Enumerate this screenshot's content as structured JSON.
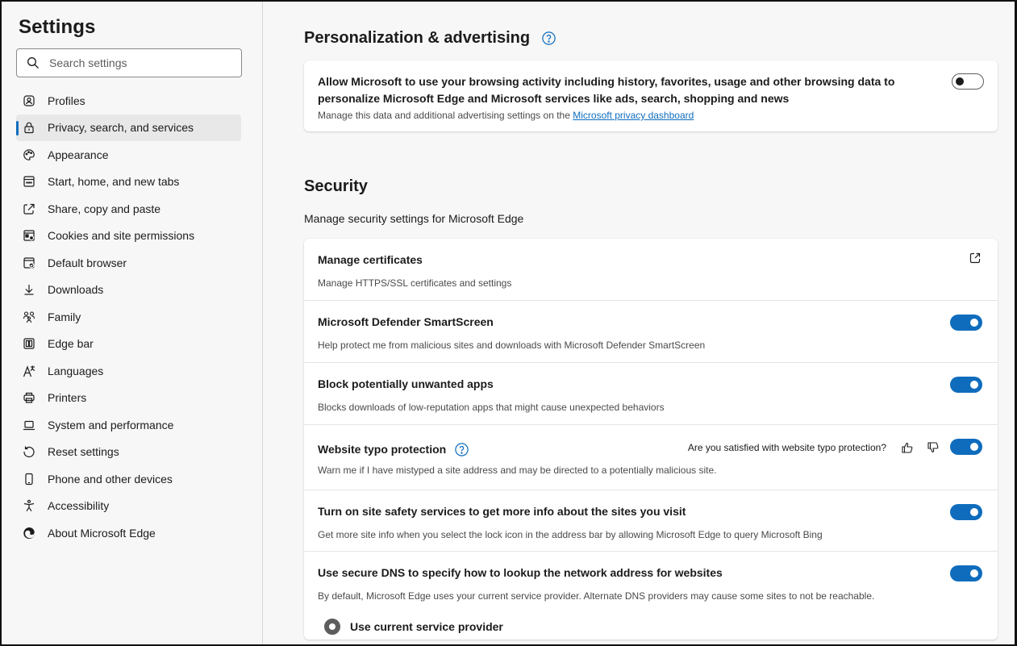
{
  "sidebar": {
    "title": "Settings",
    "search_placeholder": "Search settings",
    "items": [
      {
        "label": "Profiles",
        "icon": "profile-icon"
      },
      {
        "label": "Privacy, search, and services",
        "icon": "lock-icon",
        "active": true
      },
      {
        "label": "Appearance",
        "icon": "palette-icon"
      },
      {
        "label": "Start, home, and new tabs",
        "icon": "home-tab-icon"
      },
      {
        "label": "Share, copy and paste",
        "icon": "share-icon"
      },
      {
        "label": "Cookies and site permissions",
        "icon": "cookie-icon"
      },
      {
        "label": "Default browser",
        "icon": "browser-icon"
      },
      {
        "label": "Downloads",
        "icon": "download-icon"
      },
      {
        "label": "Family",
        "icon": "family-icon"
      },
      {
        "label": "Edge bar",
        "icon": "edge-bar-icon"
      },
      {
        "label": "Languages",
        "icon": "language-icon"
      },
      {
        "label": "Printers",
        "icon": "printer-icon"
      },
      {
        "label": "System and performance",
        "icon": "laptop-icon"
      },
      {
        "label": "Reset settings",
        "icon": "reset-icon"
      },
      {
        "label": "Phone and other devices",
        "icon": "phone-icon"
      },
      {
        "label": "Accessibility",
        "icon": "accessibility-icon"
      },
      {
        "label": "About Microsoft Edge",
        "icon": "edge-logo-icon"
      }
    ]
  },
  "personalization": {
    "title": "Personalization & advertising",
    "setting_title": "Allow Microsoft to use your browsing activity including history, favorites, usage and other browsing data to personalize Microsoft Edge and Microsoft services like ads, search, shopping and news",
    "setting_desc": "Manage this data and additional advertising settings on the",
    "link_text": "Microsoft privacy dashboard",
    "enabled": false
  },
  "security": {
    "title": "Security",
    "subtitle": "Manage security settings for Microsoft Edge",
    "rows": [
      {
        "title": "Manage certificates",
        "desc": "Manage HTTPS/SSL certificates and settings"
      },
      {
        "title": "Microsoft Defender SmartScreen",
        "desc": "Help protect me from malicious sites and downloads with Microsoft Defender SmartScreen",
        "enabled": true
      },
      {
        "title": "Block potentially unwanted apps",
        "desc": "Blocks downloads of low-reputation apps that might cause unexpected behaviors",
        "enabled": true
      },
      {
        "title": "Website typo protection",
        "desc": "Warn me if I have mistyped a site address and may be directed to a potentially malicious site.",
        "feedback_question": "Are you satisfied with website typo protection?",
        "enabled": true
      },
      {
        "title": "Turn on site safety services to get more info about the sites you visit",
        "desc": "Get more site info when you select the lock icon in the address bar by allowing Microsoft Edge to query Microsoft Bing",
        "enabled": true
      },
      {
        "title": "Use secure DNS to specify how to lookup the network address for websites",
        "desc": "By default, Microsoft Edge uses your current service provider. Alternate DNS providers may cause some sites to not be reachable.",
        "enabled": true,
        "option_label": "Use current service provider"
      }
    ]
  },
  "colors": {
    "accent": "#0f6cbd",
    "background": "#f7f7f7"
  }
}
